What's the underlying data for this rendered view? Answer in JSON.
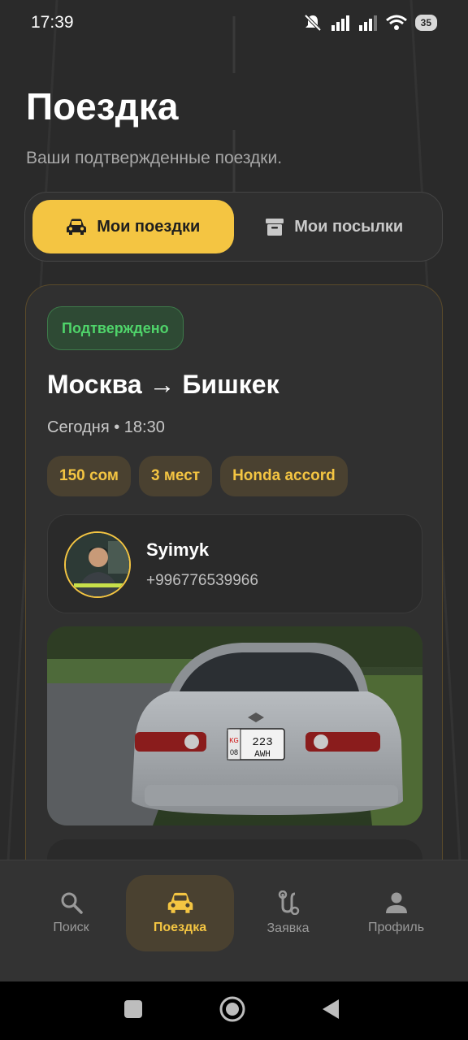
{
  "status_bar": {
    "time": "17:39",
    "battery": "35"
  },
  "page": {
    "title": "Поездка",
    "subtitle": "Ваши подтвержденные поездки."
  },
  "tabs": [
    {
      "label": "Мои поездки",
      "icon": "car-icon",
      "active": true
    },
    {
      "label": "Мои посылки",
      "icon": "archive-icon",
      "active": false
    }
  ],
  "trip": {
    "status": "Подтверждено",
    "route": "Москва → Бишкек",
    "when": "Сегодня • 18:30",
    "chips": [
      "150 сом",
      "3 мест",
      "Honda accord"
    ],
    "driver": {
      "name": "Syimyk",
      "phone": "+996776539966"
    },
    "plate": {
      "country": "KG",
      "region": "08",
      "number": "223",
      "letters": "AWH"
    }
  },
  "bottom_nav": [
    {
      "label": "Поиск",
      "icon": "search-icon",
      "active": false
    },
    {
      "label": "Поездка",
      "icon": "car-icon",
      "active": true
    },
    {
      "label": "Заявка",
      "icon": "route-icon",
      "active": false
    },
    {
      "label": "Профиль",
      "icon": "person-icon",
      "active": false
    }
  ],
  "colors": {
    "accent": "#f4c542",
    "success": "#4fd46a",
    "background": "#2a2a2a"
  }
}
